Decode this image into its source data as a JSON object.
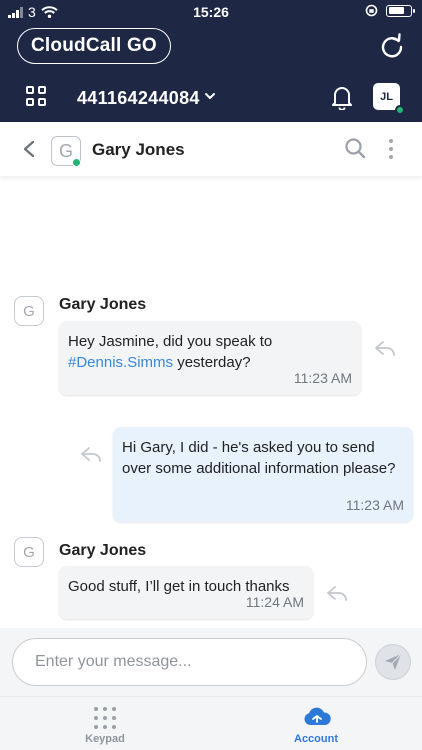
{
  "status_bar": {
    "carrier": "3",
    "time": "15:26"
  },
  "header": {
    "brand": "CloudCall GO",
    "phone_number": "441164244084",
    "user_initials": "JL"
  },
  "conversation": {
    "contact_name": "Gary Jones",
    "contact_initial": "G"
  },
  "messages": [
    {
      "direction": "incoming",
      "sender": "Gary Jones",
      "sender_initial": "G",
      "text_before": "Hey Jasmine, did you speak to",
      "mention": "#Dennis.Simms",
      "text_after": " yesterday?",
      "time": "11:23 AM"
    },
    {
      "direction": "outgoing",
      "text": "Hi Gary, I did - he's asked you to send over some additional information please?",
      "time": "11:23 AM"
    },
    {
      "direction": "incoming",
      "sender": "Gary Jones",
      "sender_initial": "G",
      "text": "Good stuff, I’ll get in touch thanks",
      "time": "11:24 AM"
    }
  ],
  "composer": {
    "placeholder": "Enter your message..."
  },
  "tabs": [
    {
      "label": "Keypad",
      "active": false,
      "icon": "keypad-icon"
    },
    {
      "label": "Account",
      "active": true,
      "icon": "account-icon"
    }
  ],
  "colors": {
    "header_bg": "#1e2744",
    "presence_green": "#22b573",
    "accent_blue": "#2f79d6",
    "outgoing_bubble": "#e7f2fc",
    "incoming_bubble": "#f3f4f6"
  }
}
